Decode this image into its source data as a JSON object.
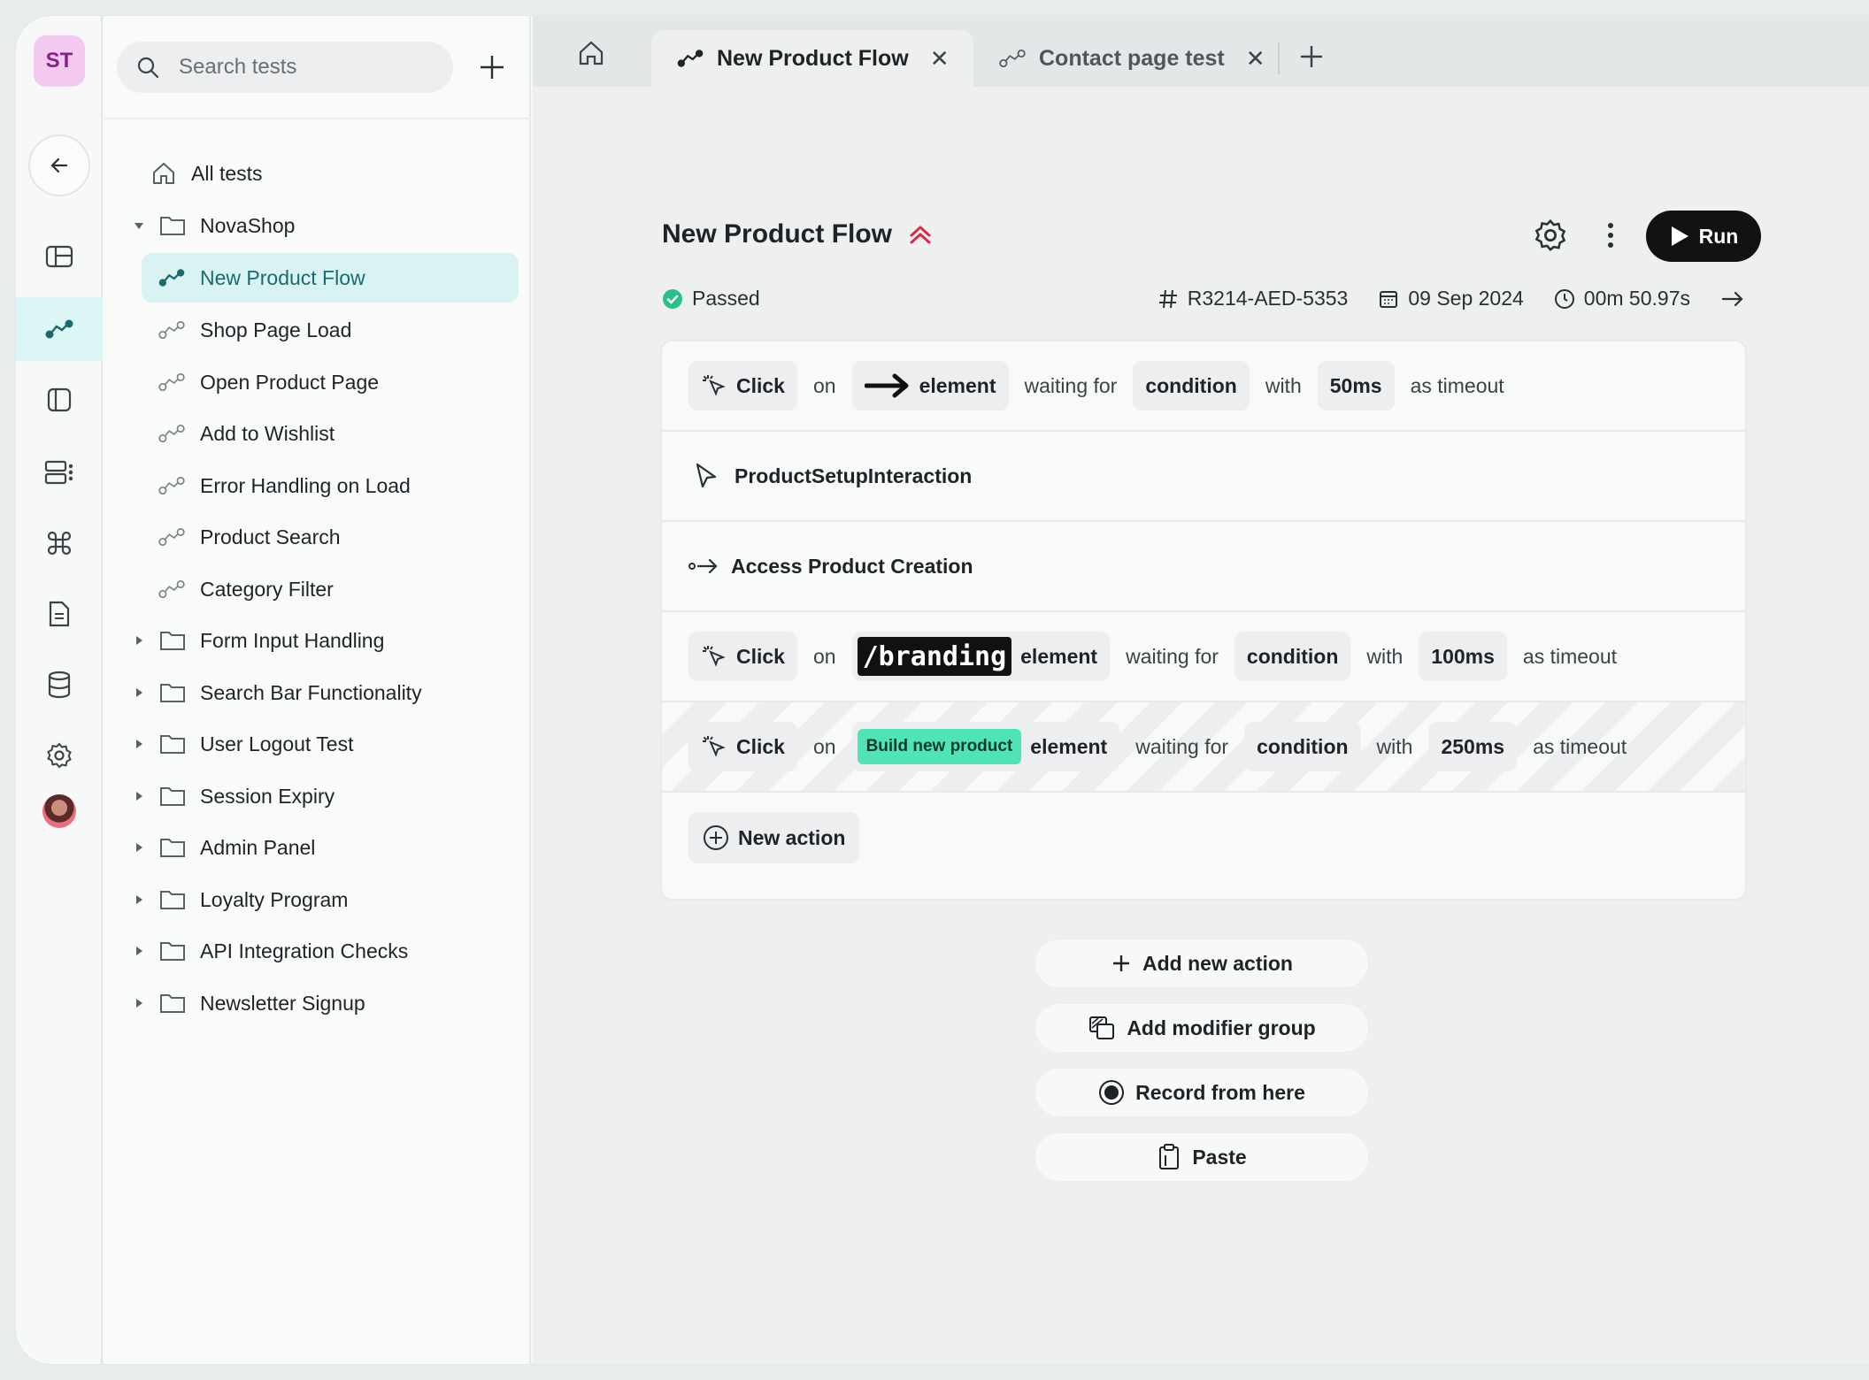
{
  "rail": {
    "avatar_initials": "ST"
  },
  "tree": {
    "search_placeholder": "Search tests",
    "items": [
      {
        "label": "All tests"
      },
      {
        "label": "NovaShop"
      },
      {
        "label": "New Product Flow"
      },
      {
        "label": "Shop Page Load"
      },
      {
        "label": "Open Product Page"
      },
      {
        "label": "Add to Wishlist"
      },
      {
        "label": "Error Handling on Load"
      },
      {
        "label": "Product Search"
      },
      {
        "label": "Category Filter"
      },
      {
        "label": "Form Input Handling"
      },
      {
        "label": "Search Bar Functionality"
      },
      {
        "label": "User Logout Test"
      },
      {
        "label": "Session Expiry"
      },
      {
        "label": "Admin Panel"
      },
      {
        "label": "Loyalty Program"
      },
      {
        "label": "API Integration Checks"
      },
      {
        "label": "Newsletter Signup"
      }
    ]
  },
  "tabs": [
    {
      "label": "New Product Flow",
      "close": "✕"
    },
    {
      "label": "Contact page test",
      "close": "✕"
    }
  ],
  "test": {
    "title": "New Product Flow",
    "run_label": "Run",
    "status": "Passed",
    "id": "R3214-AED-5353",
    "date": "09 Sep 2024",
    "duration": "00m 50.97s"
  },
  "steps": [
    {
      "action": "Click",
      "on": "on",
      "element": "element",
      "waiting": "waiting for",
      "condition": "condition",
      "with": "with",
      "timeout": "50ms",
      "as_timeout": "as timeout"
    },
    {
      "label": "ProductSetupInteraction"
    },
    {
      "label": "Access Product Creation"
    },
    {
      "action": "Click",
      "on": "on",
      "target": "/branding",
      "element": "element",
      "waiting": "waiting for",
      "condition": "condition",
      "with": "with",
      "timeout": "100ms",
      "as_timeout": "as timeout"
    },
    {
      "action": "Click",
      "on": "on",
      "target": "Build new product",
      "element": "element",
      "waiting": "waiting for",
      "condition": "condition",
      "with": "with",
      "timeout": "250ms",
      "as_timeout": "as timeout"
    }
  ],
  "new_action_label": "New action",
  "actions": {
    "add_new_action": "Add new action",
    "add_modifier_group": "Add modifier group",
    "record_from_here": "Record from here",
    "paste": "Paste"
  },
  "colors": {
    "accent": "#1b6a6c",
    "selected_bg": "#d9f3f3",
    "success": "#2bbf8a",
    "priority": "#d62d4a",
    "run_bg": "#101214"
  }
}
